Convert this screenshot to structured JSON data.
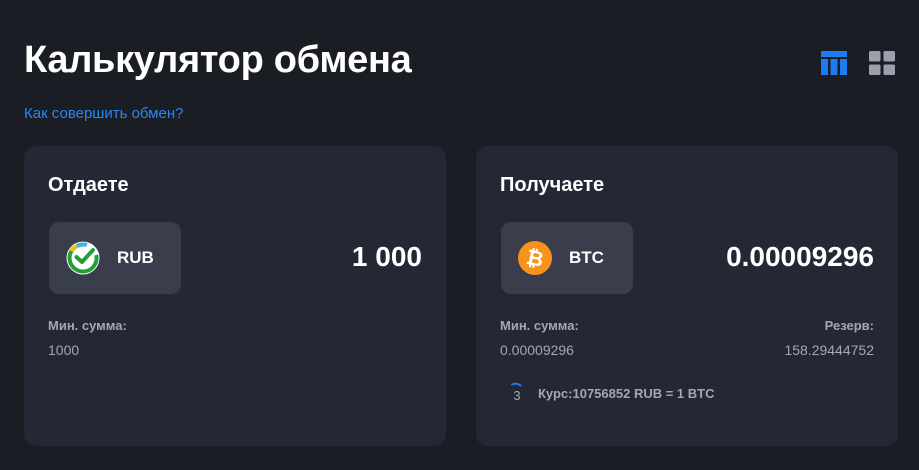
{
  "page": {
    "title": "Калькулятор обмена",
    "help_link": "Как совершить обмен?"
  },
  "view_toggle": {
    "active": "table-view",
    "accent_color": "#1d7cf2",
    "inactive_color": "#9aa0ad"
  },
  "give": {
    "title": "Отдаете",
    "currency_code": "RUB",
    "currency_icon": "sber-icon",
    "amount": "1 000",
    "min_label": "Мин. сумма:",
    "min_value": "1000"
  },
  "get": {
    "title": "Получаете",
    "currency_code": "BTC",
    "currency_icon": "bitcoin-icon",
    "amount": "0.00009296",
    "min_label": "Мин. сумма:",
    "min_value": "0.00009296",
    "reserve_label": "Резерв:",
    "reserve_value": "158.29444752",
    "rate_timer": "3",
    "rate_text": "Курс:10756852 RUB = 1 BTC"
  }
}
